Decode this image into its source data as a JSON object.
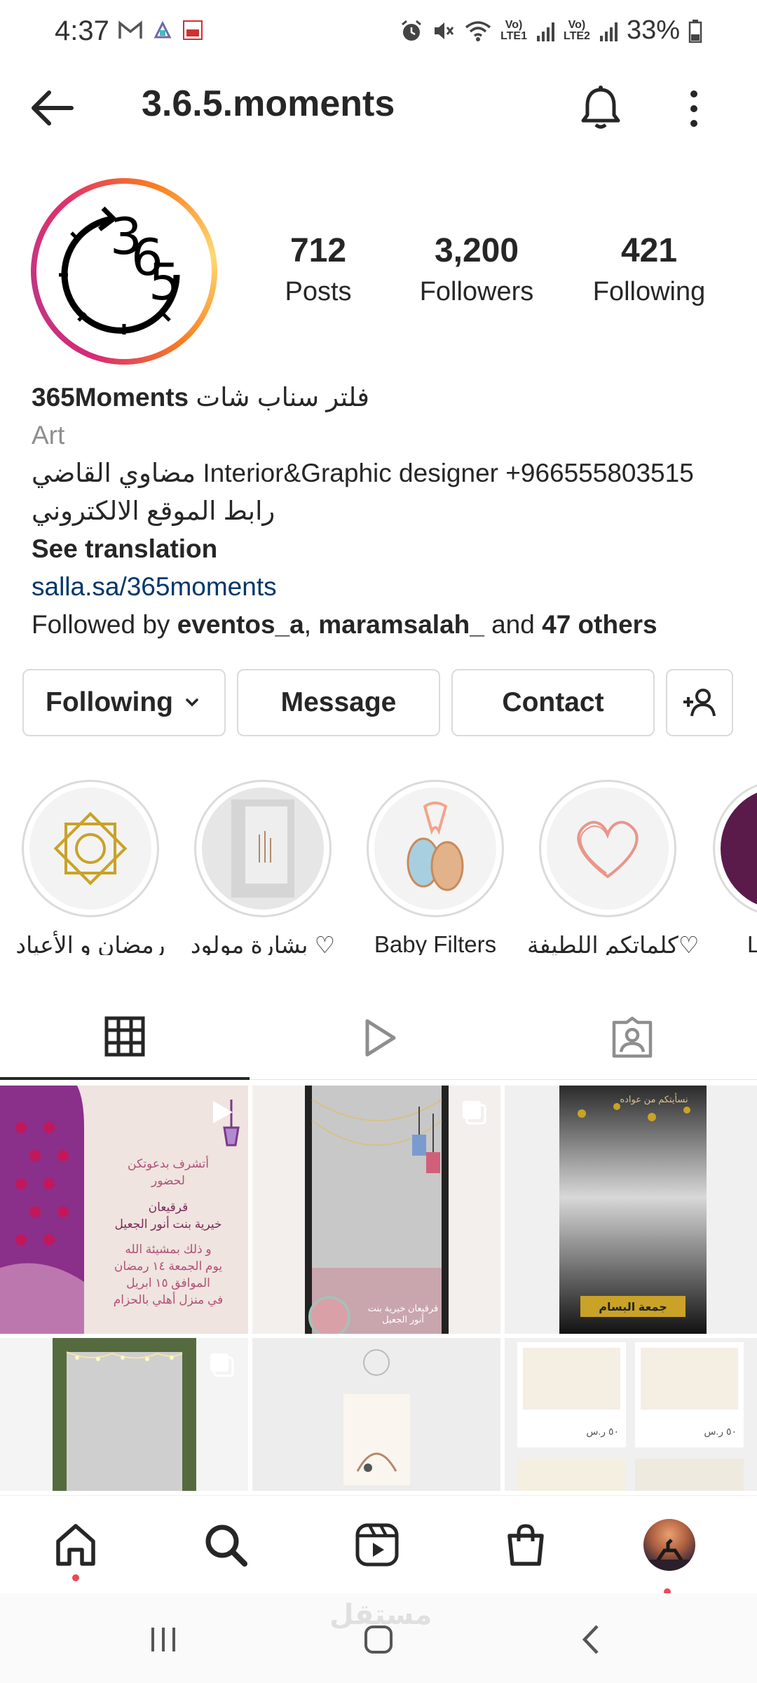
{
  "status_bar": {
    "time": "4:37",
    "battery": "33%",
    "sim1": "LTE1",
    "sim2": "LTE2",
    "vo": "Vo)"
  },
  "header": {
    "username": "3.6.5.moments"
  },
  "profile": {
    "stats": [
      {
        "value": "712",
        "label": "Posts"
      },
      {
        "value": "3,200",
        "label": "Followers"
      },
      {
        "value": "421",
        "label": "Following"
      }
    ]
  },
  "bio": {
    "name": "365Moments",
    "name_ar": "فلتر سناب شات",
    "category": "Art",
    "line1_ar": "مضاوي القاضي",
    "line1_en": "Interior&Graphic designer +966555803515",
    "line2_ar": "رابط الموقع الالكتروني",
    "translate": "See translation",
    "link": "salla.sa/365moments",
    "followed_prefix": "Followed by ",
    "followed_user1": "eventos_a",
    "followed_sep": ", ",
    "followed_user2": "maramsalah_",
    "followed_and": " and ",
    "followed_others": "47 others"
  },
  "buttons": {
    "following": "Following",
    "message": "Message",
    "contact": "Contact"
  },
  "highlights": [
    {
      "label": "رمضان و الأعياد"
    },
    {
      "label": "بشارة مولود ♡"
    },
    {
      "label": "Baby Filters"
    },
    {
      "label": "كلماتكم اللطيفة♡"
    },
    {
      "label": "L"
    }
  ],
  "posts": {
    "post1_lines": [
      "أتشرف بدعوتكن",
      "لحضور",
      "قرقيعان",
      "خيرية بنت أنور الجعيل",
      "و ذلك بمشيئة الله",
      "يوم الجمعة ١٤ رمضان",
      "الموافق ١٥ ابريل",
      "في منزل أهلي بالحزام"
    ],
    "post2_text": "قرقيعان خيرية بنت أنور الجعيل",
    "post3_text": "جمعة البسام",
    "post3_top": "نسأيتكم من عواده",
    "post6_price": "٥٠ ر.س"
  },
  "system": {
    "watermark": "مستقل"
  },
  "colors": {
    "link": "#00376b",
    "notification_dot": "#ed4956",
    "border": "#dbdbdb"
  }
}
